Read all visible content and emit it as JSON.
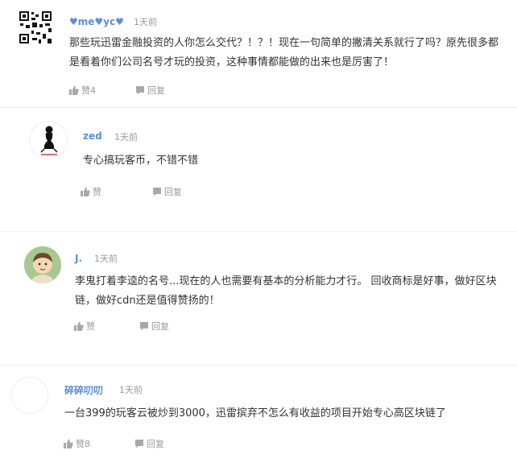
{
  "comments": [
    {
      "username": "♥me♥yc♥",
      "time": "1天前",
      "text": "那些玩迅雷金融投资的人你怎么交代？！？！现在一句简单的撇清关系就行了吗？原先很多都是看着你们公司名号才玩的投资，这种事情都能做的出来也是厉害了！",
      "like": "赞4",
      "reply": "回复"
    },
    {
      "username": "zed",
      "time": "1天前",
      "text": "专心搞玩客币，不错不错",
      "like": "赞",
      "reply": "回复"
    },
    {
      "username": "J.",
      "time": "1天前",
      "text": "李鬼打着李逵的名号...现在的人也需要有基本的分析能力才行。 回收商标是好事，做好区块链，做好cdn还是值得赞扬的！",
      "like": "赞",
      "reply": "回复"
    },
    {
      "username": "碎碎叨叨",
      "time": "1天前",
      "text": "一台399的玩客云被炒到3000，迅雷摈弃不怎么有收益的项目开始专心高区块链了",
      "like": "赞8",
      "reply": "回复"
    }
  ],
  "colors": {
    "name": "#5a8fd6",
    "meta": "#9a9a9a",
    "text": "#333333"
  }
}
